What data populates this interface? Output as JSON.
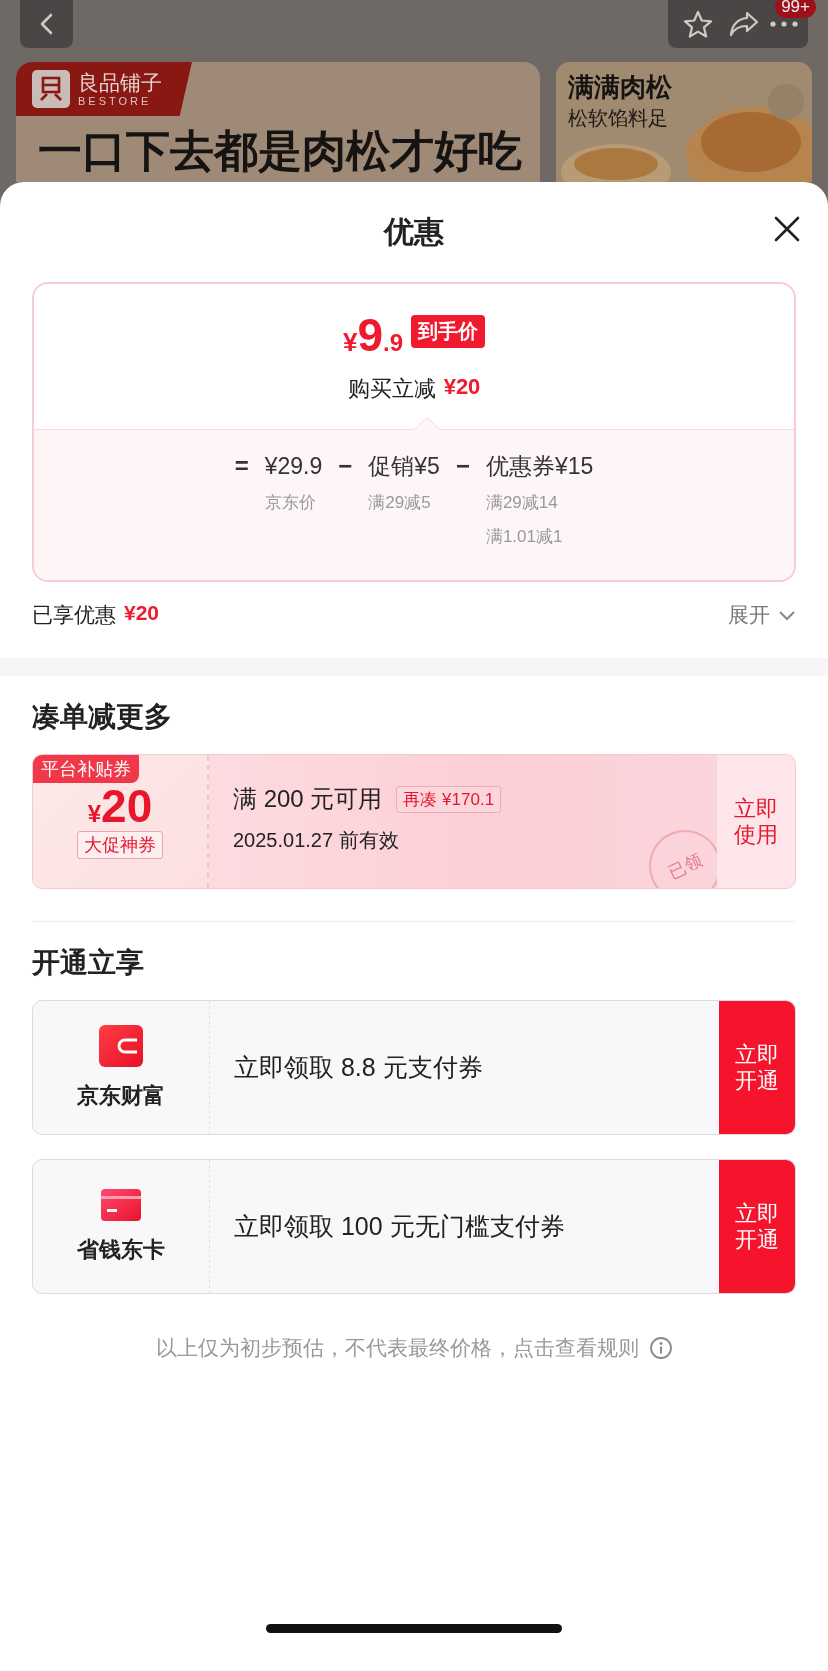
{
  "top_bar": {
    "badge": "99+"
  },
  "banner": {
    "brand": "良品铺子",
    "brand_en": "BESTORE",
    "headline": "一口下去都是肉松才好吃",
    "side_title": "满满肉松",
    "side_subtitle": "松软馅料足"
  },
  "sheet": {
    "title": "优惠"
  },
  "price_card": {
    "currency": "¥",
    "price_int": "9",
    "price_dec": ".9",
    "price_tag": "到手价",
    "saving_label": "购买立减",
    "saving_amount": "¥20",
    "breakdown": [
      {
        "op": "=",
        "amount": "¥29.9",
        "notes": [
          "京东价"
        ]
      },
      {
        "op": "−",
        "amount": "促销¥5",
        "notes": [
          "满29减5"
        ]
      },
      {
        "op": "−",
        "amount": "优惠券¥15",
        "notes": [
          "满29减14",
          "满1.01减1"
        ]
      }
    ]
  },
  "enjoyed": {
    "label": "已享优惠",
    "amount": "¥20",
    "toggle": "展开",
    "expanded": false
  },
  "add_on": {
    "title": "凑单减更多",
    "coupon": {
      "ribbon": "平台补贴券",
      "currency": "¥",
      "amount": "20",
      "tag": "大促神券",
      "condition": "满 200 元可用",
      "gap": "再凑 ¥170.1",
      "validity": "2025.01.27 前有效",
      "stamp": "已领",
      "action": "立即使用"
    }
  },
  "open_offers": {
    "title": "开通立享",
    "items": [
      {
        "kind": "wallet",
        "name": "京东财富",
        "offer": "立即领取 8.8 元支付券",
        "action": "立即开通"
      },
      {
        "kind": "card",
        "name": "省钱东卡",
        "offer": "立即领取 100 元无门槛支付券",
        "action": "立即开通"
      }
    ]
  },
  "footer": {
    "note": "以上仅为初步预估，不代表最终价格，点击查看规则"
  }
}
